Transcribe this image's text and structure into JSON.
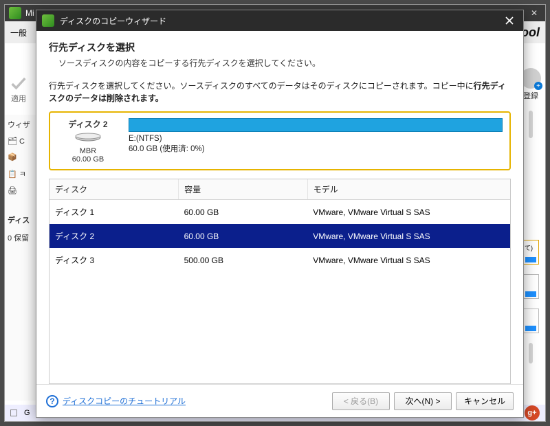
{
  "back_window": {
    "title_prefix": "Mi",
    "system_min": "—",
    "system_max": "☐",
    "system_close": "✕",
    "toolbar_general": "一般",
    "brand_tail": "ool",
    "apply_label": "適用",
    "register_label": "登録",
    "left_items": [
      "ウィザ",
      "🗂 C",
      "📦",
      "📋 ㅋ",
      "🖨",
      "",
      ""
    ],
    "section1": "ディス",
    "section2": "0 保留",
    "status_prefix": "G",
    "thumb_letter": "て)"
  },
  "wizard": {
    "title": "ディスクのコピーウィザード",
    "heading": "行先ディスクを選択",
    "subheading": "ソースディスクの内容をコピーする行先ディスクを選択してください。",
    "instruction_pre": "行先ディスクを選択してください。ソースディスクのすべてのデータはそのディスクにコピーされます。コピー中に",
    "instruction_bold": "行先ディスクのデータは削除されます。",
    "selected": {
      "name": "ディスク 2",
      "scheme": "MBR",
      "size": "60.00 GB",
      "volume": "E:(NTFS)",
      "usage": "60.0 GB (使用済: 0%)"
    },
    "columns": {
      "disk": "ディスク",
      "capacity": "容量",
      "model": "モデル"
    },
    "rows": [
      {
        "name": "ディスク 1",
        "capacity": "60.00 GB",
        "model": "VMware, VMware Virtual S SAS",
        "selected": false
      },
      {
        "name": "ディスク 2",
        "capacity": "60.00 GB",
        "model": "VMware, VMware Virtual S SAS",
        "selected": true
      },
      {
        "name": "ディスク 3",
        "capacity": "500.00 GB",
        "model": "VMware, VMware Virtual S SAS",
        "selected": false
      }
    ],
    "tutorial_link": "ディスクコピーのチュートリアル",
    "buttons": {
      "back": "< 戻る(B)",
      "next": "次へ(N) >",
      "cancel": "キャンセル"
    }
  }
}
